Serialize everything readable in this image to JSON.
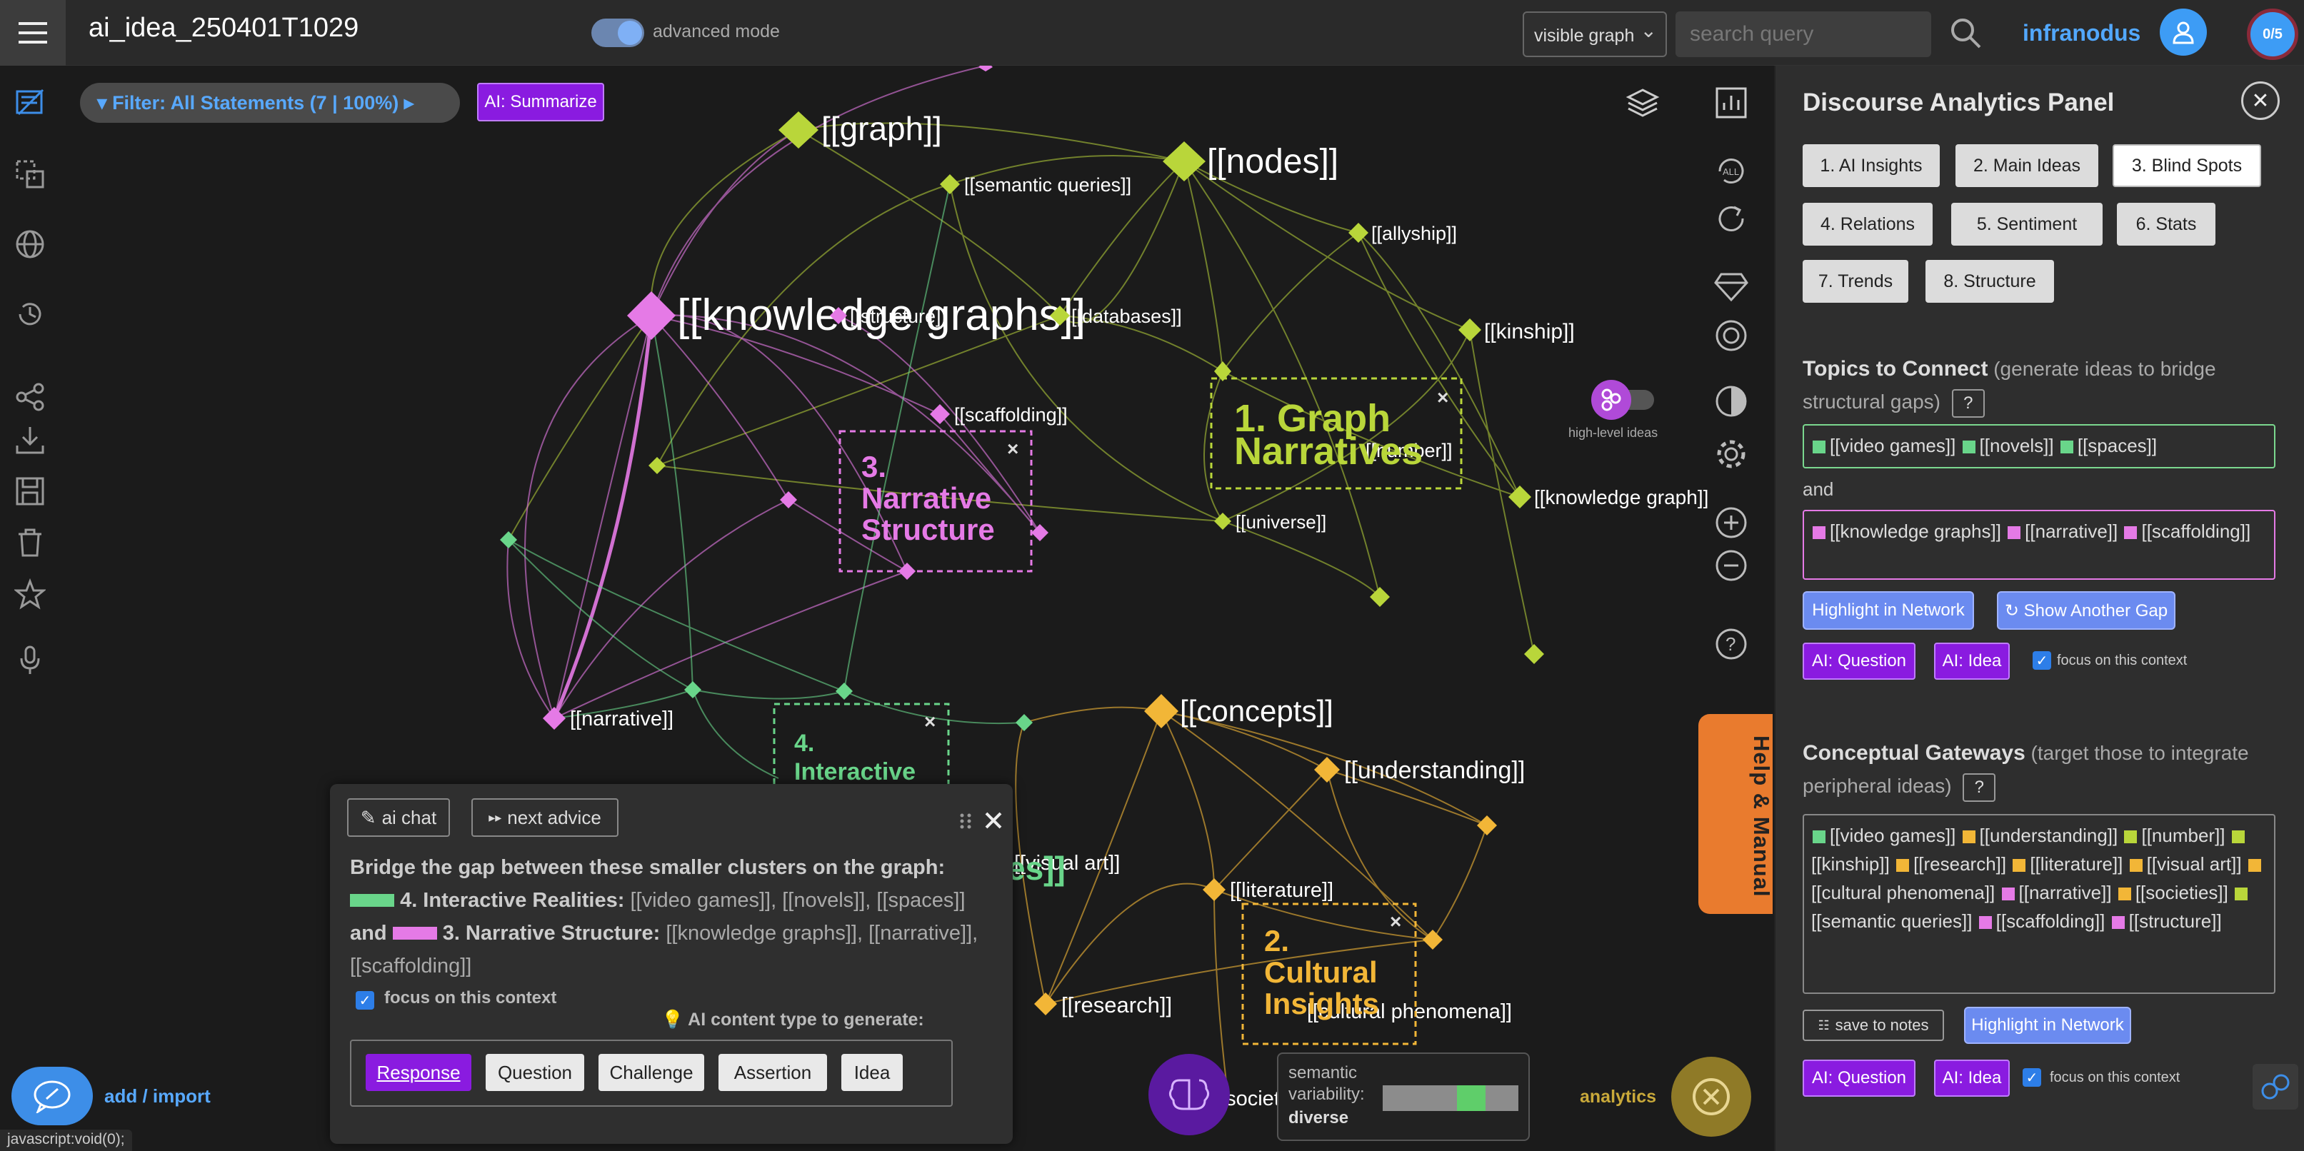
{
  "header": {
    "title": "ai_idea_250401T1029",
    "advanced_mode_label": "advanced mode",
    "graph_select": "visible graph",
    "search_placeholder": "search query",
    "brand": "infranodus",
    "counter": "0/5"
  },
  "graph": {
    "filter_label": "Filter: All Statements (7 | 100%)",
    "summarize_label": "AI: Summarize",
    "high_level_label": "high-level ideas",
    "nodes": [
      {
        "label": "[[graph]]",
        "color": "#b9d63a",
        "size": "l"
      },
      {
        "label": "[[nodes]]",
        "color": "#b9d63a",
        "size": "l"
      },
      {
        "label": "[[semantic queries]]",
        "color": "#b9d63a",
        "size": "s"
      },
      {
        "label": "[[allyship]]",
        "color": "#b9d63a",
        "size": "s"
      },
      {
        "label": "[[knowledge graphs]]",
        "color": "#e57ae6",
        "size": "xl"
      },
      {
        "label": "[[structure]]",
        "color": "#e57ae6",
        "size": "s"
      },
      {
        "label": "[[databases]]",
        "color": "#b9d63a",
        "size": "s"
      },
      {
        "label": "[[kinship]]",
        "color": "#b9d63a",
        "size": "s"
      },
      {
        "label": "[[scaffolding]]",
        "color": "#e57ae6",
        "size": "s"
      },
      {
        "label": "[[number]]",
        "color": "#b9d63a",
        "size": "s"
      },
      {
        "label": "[[knowledge graph]]",
        "color": "#b9d63a",
        "size": "s"
      },
      {
        "label": "[[universe]]",
        "color": "#b9d63a",
        "size": "s"
      },
      {
        "label": "[[narrative]]",
        "color": "#e57ae6",
        "size": "s"
      },
      {
        "label": "[[concepts]]",
        "color": "#f2b637",
        "size": "l"
      },
      {
        "label": "[[understanding]]",
        "color": "#f2b637",
        "size": "m"
      },
      {
        "label": "[[visual art]]",
        "color": "#f2b637",
        "size": "s"
      },
      {
        "label": "[[literature]]",
        "color": "#f2b637",
        "size": "s"
      },
      {
        "label": "[[research]]",
        "color": "#f2b637",
        "size": "s"
      },
      {
        "label": "[[cultural phenomena]]",
        "color": "#f2b637",
        "size": "s"
      },
      {
        "label": "[[societies]]",
        "color": "#f2b637",
        "size": "s"
      }
    ],
    "clusters": [
      {
        "label": "1. Graph Narratives",
        "color": "#b9d63a"
      },
      {
        "label": "3. Narrative Structure",
        "color": "#e57ae6"
      },
      {
        "label": "4. Interactive Realities",
        "color": "#69d58a"
      },
      {
        "label": "2. Cultural Insights",
        "color": "#f2b637"
      }
    ]
  },
  "panel": {
    "title": "Discourse Analytics Panel",
    "tabs": [
      "1. AI Insights",
      "2. Main Ideas",
      "3. Blind Spots",
      "4. Relations",
      "5. Sentiment",
      "6. Stats",
      "7. Trends",
      "8. Structure"
    ],
    "active_tab": "3. Blind Spots",
    "topics": {
      "title": "Topics to Connect",
      "desc": "(generate ideas to bridge structural gaps)",
      "help": "?",
      "group_a": [
        {
          "text": "[[video games]]",
          "color": "#69d58a"
        },
        {
          "text": "[[novels]]",
          "color": "#69d58a"
        },
        {
          "text": "[[spaces]]",
          "color": "#69d58a"
        }
      ],
      "and_label": "and",
      "group_b": [
        {
          "text": "[[knowledge graphs]]",
          "color": "#e57ae6"
        },
        {
          "text": "[[narrative]]",
          "color": "#e57ae6"
        },
        {
          "text": "[[scaffolding]]",
          "color": "#e57ae6"
        }
      ],
      "highlight_label": "Highlight in Network",
      "show_gap_label": "↻ Show Another Gap",
      "ai_question": "AI: Question",
      "ai_idea": "AI: Idea",
      "focus_label": "focus on this context"
    },
    "gateways": {
      "title": "Conceptual Gateways",
      "desc": "(target those to integrate peripheral ideas)",
      "help": "?",
      "items": [
        {
          "text": "[[video games]]",
          "color": "#69d58a"
        },
        {
          "text": "[[understanding]]",
          "color": "#f2b637"
        },
        {
          "text": "[[number]]",
          "color": "#b9d63a"
        },
        {
          "text": "[[kinship]]",
          "color": "#b9d63a"
        },
        {
          "text": "[[research]]",
          "color": "#f2b637"
        },
        {
          "text": "[[literature]]",
          "color": "#f2b637"
        },
        {
          "text": "[[visual art]]",
          "color": "#f2b637"
        },
        {
          "text": "[[cultural phenomena]]",
          "color": "#f2b637"
        },
        {
          "text": "[[narrative]]",
          "color": "#e57ae6"
        },
        {
          "text": "[[societies]]",
          "color": "#f2b637"
        },
        {
          "text": "[[semantic queries]]",
          "color": "#b9d63a"
        },
        {
          "text": "[[scaffolding]]",
          "color": "#e57ae6"
        },
        {
          "text": "[[structure]]",
          "color": "#e57ae6"
        }
      ],
      "save_label": "save to notes",
      "highlight_label": "Highlight in Network",
      "ai_question": "AI: Question",
      "ai_idea": "AI: Idea",
      "focus_label": "focus on this context"
    }
  },
  "advice": {
    "ai_chat_label": "ai chat",
    "next_advice_label": "next advice",
    "text_intro": "Bridge the gap between these smaller clusters on the graph:",
    "cluster_a_name": "4. Interactive Realities:",
    "cluster_a_items": "[[video games]], [[novels]], [[spaces]]",
    "and_word": "and",
    "cluster_b_name": "3. Narrative Structure:",
    "cluster_b_items": "[[knowledge graphs]], [[narrative]], [[scaffolding]]",
    "focus_label": "focus on this context",
    "type_label": "AI content type to generate:",
    "types": [
      "Response",
      "Question",
      "Challenge",
      "Assertion",
      "Idea"
    ],
    "selected_type": "Response"
  },
  "bottom": {
    "add_import_label": "add / import",
    "status_text": "javascript:void(0);",
    "sv_label_1": "semantic",
    "sv_label_2": "variability:",
    "sv_value": "diverse",
    "analytics_label": "analytics",
    "help_label": "Help & Manual"
  },
  "colors": {
    "green_cluster": "#b9d63a",
    "pink_cluster": "#e57ae6",
    "teal_cluster": "#69d58a",
    "orange_cluster": "#f2b637",
    "accent_blue": "#52a8ff",
    "purple_button": "#8a1be0"
  }
}
